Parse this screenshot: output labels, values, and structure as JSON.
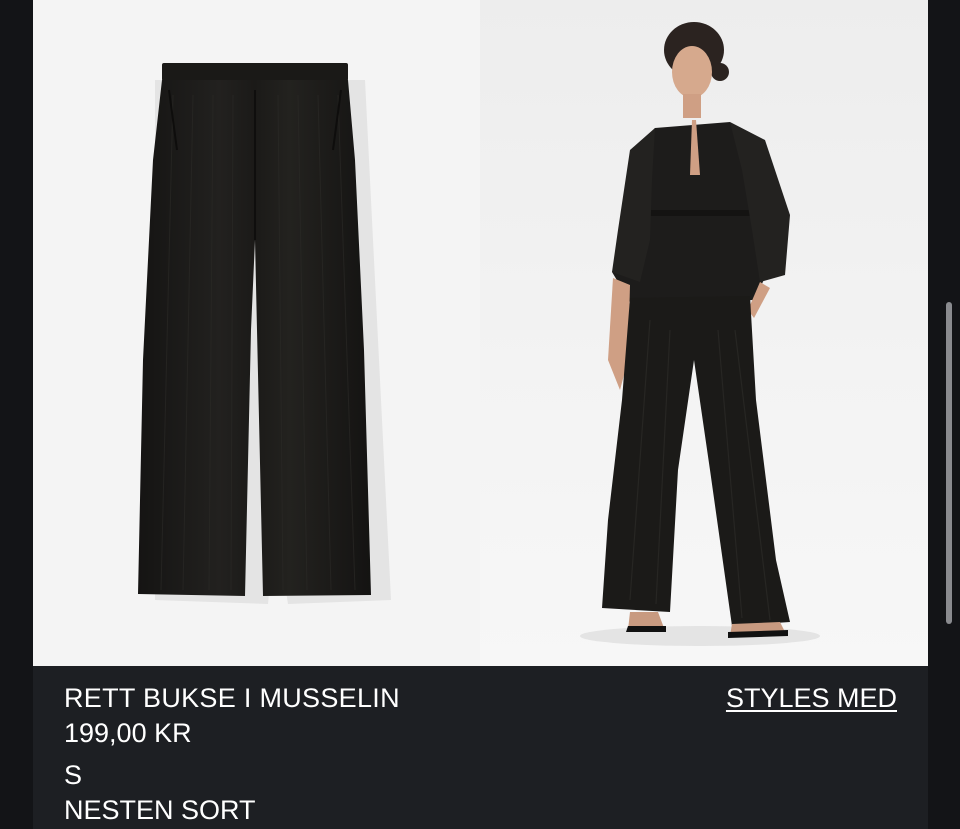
{
  "product": {
    "title": "RETT BUKSE I MUSSELIN",
    "price": "199,00 KR",
    "size": "S",
    "color": "NESTEN SORT"
  },
  "links": {
    "styles_with": "STYLES MED"
  },
  "colors": {
    "background": "#131417",
    "info_bar": "#1d1f23",
    "text": "#ffffff",
    "garment": "#1c1b19"
  },
  "images": [
    {
      "kind": "product-flat-lay",
      "icon": "trousers-image"
    },
    {
      "kind": "model-wearing-outfit",
      "icon": "model-image"
    }
  ]
}
